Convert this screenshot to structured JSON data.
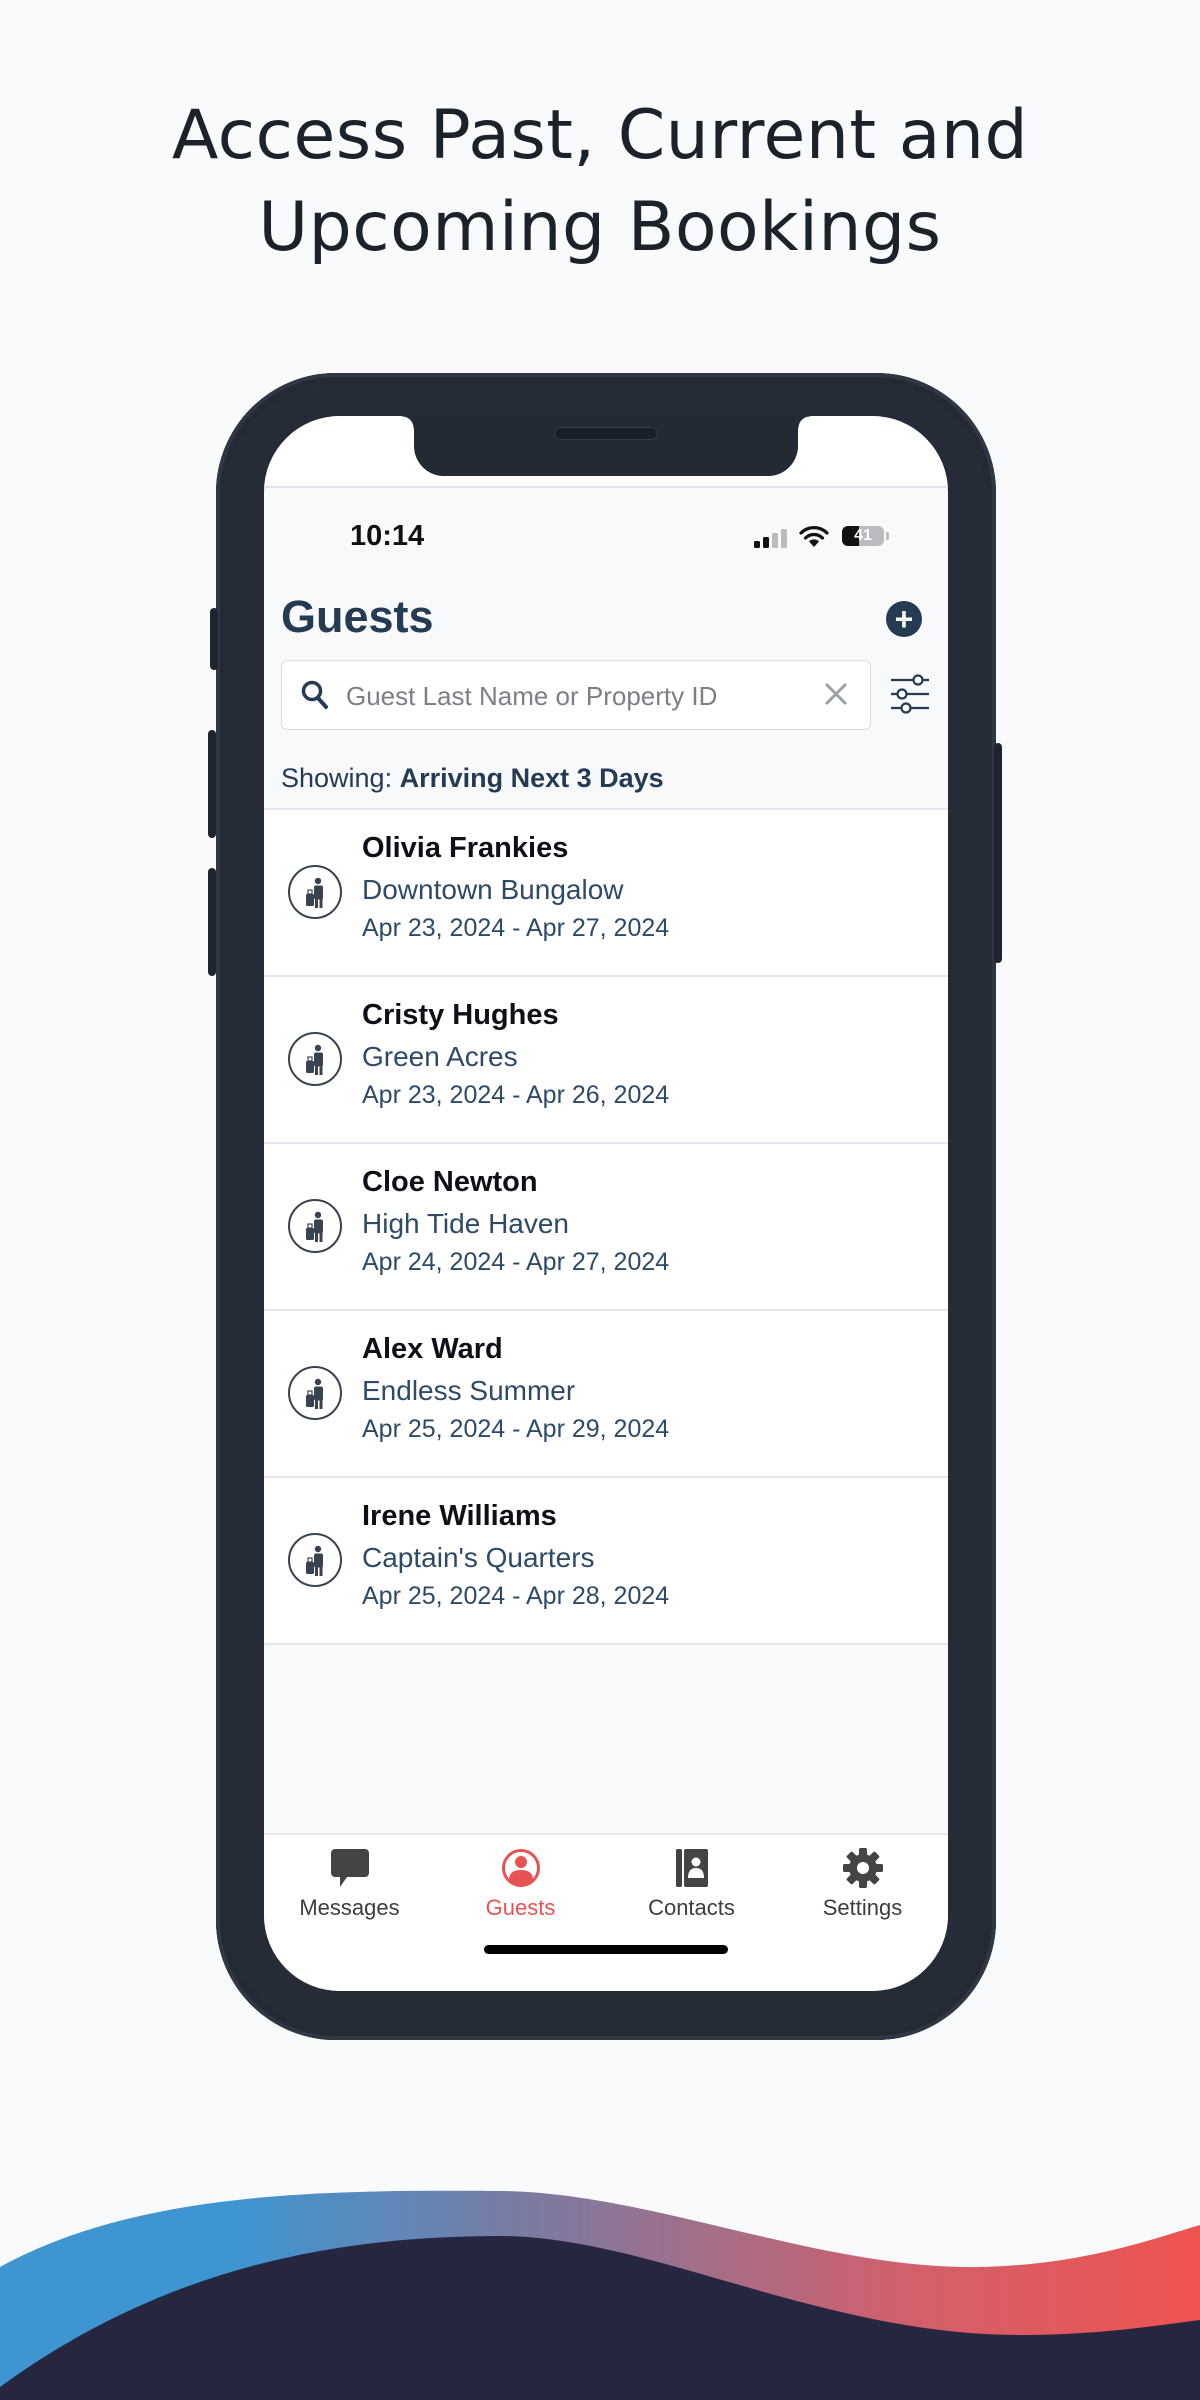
{
  "headline": {
    "line1": "Access Past, Current and",
    "line2": "Upcoming Bookings"
  },
  "status_bar": {
    "time": "10:14",
    "battery_percent": 41,
    "battery_label": "41",
    "signal_bars_active": 2,
    "signal_bars_total": 4
  },
  "header": {
    "title": "Guests",
    "add_icon": "plus-circle-icon"
  },
  "search": {
    "placeholder": "Guest Last Name or Property ID",
    "value": "",
    "search_icon": "search-icon",
    "clear_icon": "close-icon",
    "filter_icon": "sliders-icon"
  },
  "filter_summary": {
    "label": "Showing:",
    "value": "Arriving Next 3 Days"
  },
  "guests": [
    {
      "name": "Olivia Frankies",
      "property": "Downtown Bungalow",
      "dates": "Apr 23, 2024 - Apr 27, 2024"
    },
    {
      "name": "Cristy Hughes",
      "property": "Green Acres",
      "dates": "Apr 23, 2024 - Apr 26, 2024"
    },
    {
      "name": "Cloe Newton",
      "property": "High Tide Haven",
      "dates": "Apr 24, 2024 - Apr 27, 2024"
    },
    {
      "name": "Alex Ward",
      "property": "Endless Summer",
      "dates": "Apr 25, 2024 - Apr 29, 2024"
    },
    {
      "name": "Irene Williams",
      "property": "Captain's Quarters",
      "dates": "Apr 25, 2024 - Apr 28, 2024"
    }
  ],
  "tabs": [
    {
      "label": "Messages",
      "icon": "chat-bubble-icon",
      "active": false
    },
    {
      "label": "Guests",
      "icon": "user-circle-icon",
      "active": true
    },
    {
      "label": "Contacts",
      "icon": "address-book-icon",
      "active": false
    },
    {
      "label": "Settings",
      "icon": "gear-icon",
      "active": false
    }
  ],
  "colors": {
    "primary": "#243b53",
    "accent": "#e85252",
    "wave_blue": "#3f95d0",
    "wave_red": "#ef5350",
    "wave_dark": "#272640",
    "phone_frame": "#252c37"
  }
}
